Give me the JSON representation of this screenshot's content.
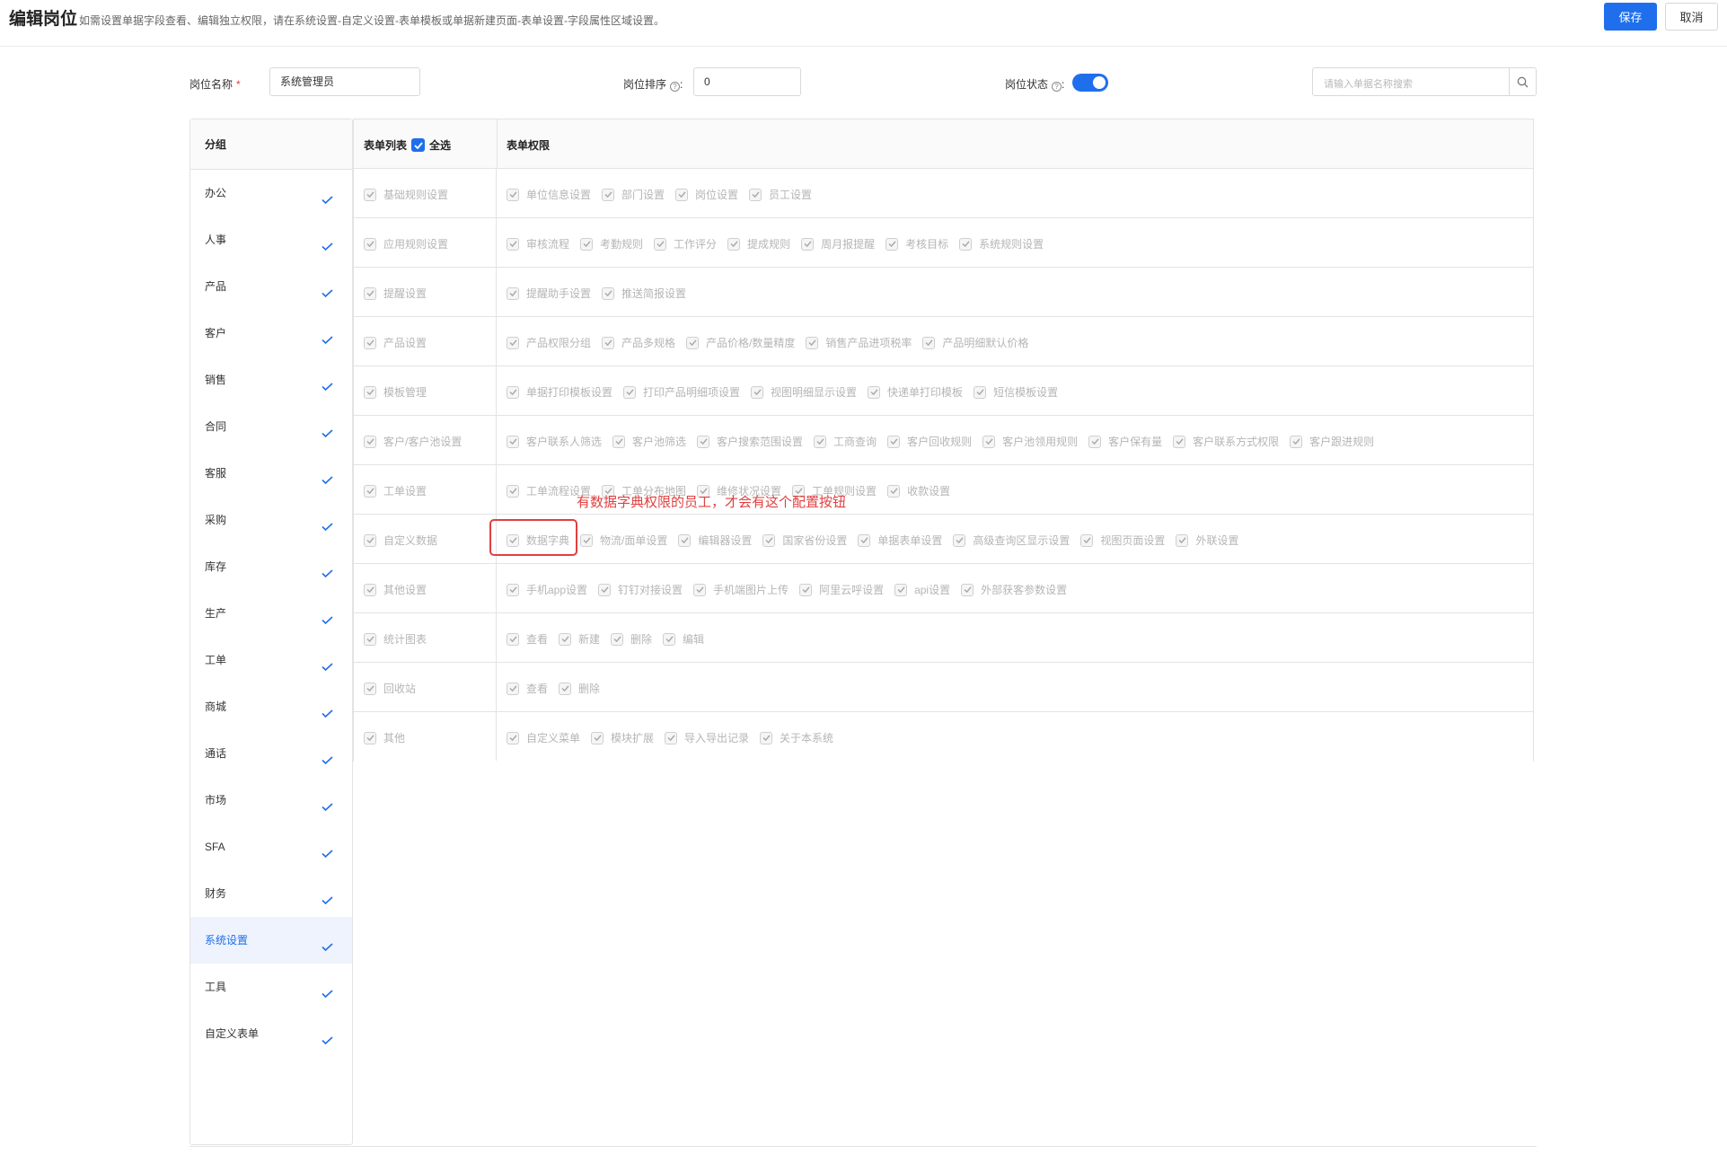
{
  "header": {
    "title": "编辑岗位",
    "description": "如需设置单据字段查看、编辑独立权限，请在系统设置-自定义设置-表单模板或单据新建页面-表单设置-字段属性区域设置。",
    "save_label": "保存",
    "cancel_label": "取消"
  },
  "form": {
    "name_label": "岗位名称",
    "required_mark": "*",
    "name_value": "系统管理员",
    "order_label": "岗位排序",
    "order_value": "0",
    "status_label": "岗位状态",
    "status_on": true,
    "search_placeholder": "请输入单据名称搜索"
  },
  "sidebar": {
    "header": "分组",
    "items": [
      {
        "label": "办公"
      },
      {
        "label": "人事"
      },
      {
        "label": "产品"
      },
      {
        "label": "客户"
      },
      {
        "label": "销售"
      },
      {
        "label": "合同"
      },
      {
        "label": "客服"
      },
      {
        "label": "采购"
      },
      {
        "label": "库存"
      },
      {
        "label": "生产"
      },
      {
        "label": "工单"
      },
      {
        "label": "商城"
      },
      {
        "label": "通话"
      },
      {
        "label": "市场"
      },
      {
        "label": "SFA"
      },
      {
        "label": "财务"
      },
      {
        "label": "系统设置",
        "active": true
      },
      {
        "label": "工具"
      },
      {
        "label": "自定义表单"
      }
    ]
  },
  "table": {
    "col_forms": "表单列表",
    "select_all": "全选",
    "col_perms": "表单权限",
    "rows": [
      {
        "form": "基础规则设置",
        "perms": [
          "单位信息设置",
          "部门设置",
          "岗位设置",
          "员工设置"
        ]
      },
      {
        "form": "应用规则设置",
        "perms": [
          "审核流程",
          "考勤规则",
          "工作评分",
          "提成规则",
          "周月报提醒",
          "考核目标",
          "系统规则设置"
        ]
      },
      {
        "form": "提醒设置",
        "perms": [
          "提醒助手设置",
          "推送简报设置"
        ]
      },
      {
        "form": "产品设置",
        "perms": [
          "产品权限分组",
          "产品多规格",
          "产品价格/数量精度",
          "销售产品进项税率",
          "产品明细默认价格"
        ]
      },
      {
        "form": "模板管理",
        "perms": [
          "单据打印模板设置",
          "打印产品明细项设置",
          "视图明细显示设置",
          "快递单打印模板",
          "短信模板设置"
        ]
      },
      {
        "form": "客户/客户池设置",
        "perms": [
          "客户联系人筛选",
          "客户池筛选",
          "客户搜索范围设置",
          "工商查询",
          "客户回收规则",
          "客户池领用规则",
          "客户保有量",
          "客户联系方式权限",
          "客户跟进规则"
        ]
      },
      {
        "form": "工单设置",
        "perms": [
          "工单流程设置",
          "工单分布地图",
          "维修状况设置",
          "工单规则设置",
          "收款设置"
        ]
      },
      {
        "form": "自定义数据",
        "perms": [
          "数据字典",
          "物流/面单设置",
          "编辑器设置",
          "国家省份设置",
          "单据表单设置",
          "高级查询区显示设置",
          "视图页面设置",
          "外联设置"
        ]
      },
      {
        "form": "其他设置",
        "perms": [
          "手机app设置",
          "钉钉对接设置",
          "手机端图片上传",
          "阿里云呼设置",
          "api设置",
          "外部获客参数设置"
        ]
      },
      {
        "form": "统计图表",
        "perms": [
          "查看",
          "新建",
          "删除",
          "编辑"
        ]
      },
      {
        "form": "回收站",
        "perms": [
          "查看",
          "删除"
        ]
      },
      {
        "form": "其他",
        "perms": [
          "自定义菜单",
          "模块扩展",
          "导入导出记录",
          "关于本系统"
        ]
      }
    ]
  },
  "annotation": {
    "text": "有数据字典权限的员工，才会有这个配置按钮"
  },
  "colors": {
    "accent": "#1f6fec",
    "annotation": "#e04040",
    "disabled_text": "#b5b5b5"
  }
}
